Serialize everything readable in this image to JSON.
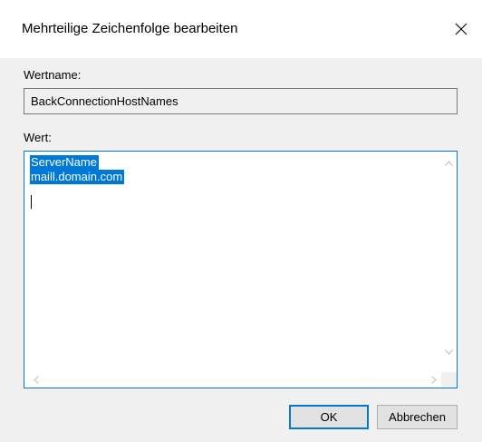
{
  "dialog": {
    "title": "Mehrteilige Zeichenfolge bearbeiten",
    "close_icon": "close-icon"
  },
  "name_field": {
    "label": "Wertname:",
    "value": "BackConnectionHostNames"
  },
  "value_field": {
    "label": "Wert:",
    "lines": [
      "ServerName",
      "maill.domain.com"
    ],
    "selection_color": "#0078d7"
  },
  "buttons": {
    "ok_label": "OK",
    "cancel_label": "Abbrechen"
  },
  "colors": {
    "accent": "#0078d7",
    "background": "#f0f0f0"
  }
}
